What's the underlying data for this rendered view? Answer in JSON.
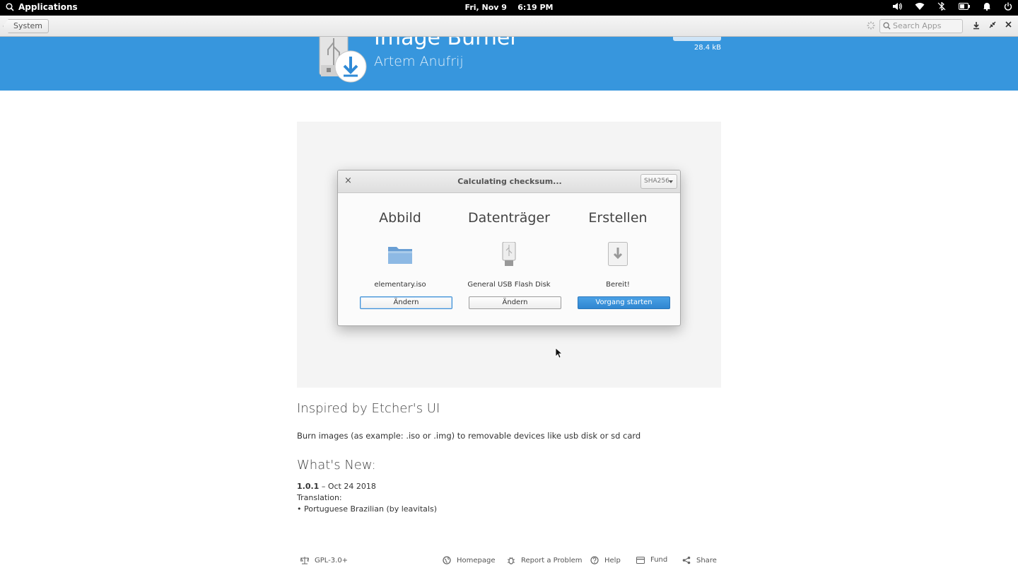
{
  "panel": {
    "applications_label": "Applications",
    "date": "Fri, Nov 9",
    "time": "6:19 PM",
    "indicators": [
      "volume-icon",
      "wifi-icon",
      "bluetooth-off-icon",
      "battery-icon",
      "notifications-icon",
      "power-icon"
    ]
  },
  "headerbar": {
    "back_label": "System",
    "search_placeholder": "Search Apps"
  },
  "app": {
    "title": "Image Burner",
    "author": "Artem Anufrij",
    "size": "28.4 kB"
  },
  "screenshot_dialog": {
    "title": "Calculating checksum...",
    "hash_type": "SHA256",
    "columns": [
      {
        "heading": "Abbild",
        "label": "elementary.iso",
        "button": "Ändern",
        "icon": "folder-icon"
      },
      {
        "heading": "Datenträger",
        "label": "General USB Flash Disk",
        "button": "Ändern",
        "icon": "usb-drive-icon"
      },
      {
        "heading": "Erstellen",
        "label": "Bereit!",
        "button": "Vorgang starten",
        "icon": "download-icon"
      }
    ]
  },
  "description": {
    "heading": "Inspired by Etcher's UI",
    "text": "Burn images (as example: .iso or .img) to removable devices like usb disk or sd card"
  },
  "whats_new": {
    "heading": "What's New:",
    "version": "1.0.1",
    "date": " – Oct 24 2018",
    "section": "Translation:",
    "items": [
      "• Portuguese Brazilian (by leavitals)"
    ]
  },
  "footer": {
    "license": "GPL-3.0+",
    "homepage": "Homepage",
    "report": "Report a Problem",
    "help": "Help",
    "fund": "Fund",
    "share": "Share"
  }
}
